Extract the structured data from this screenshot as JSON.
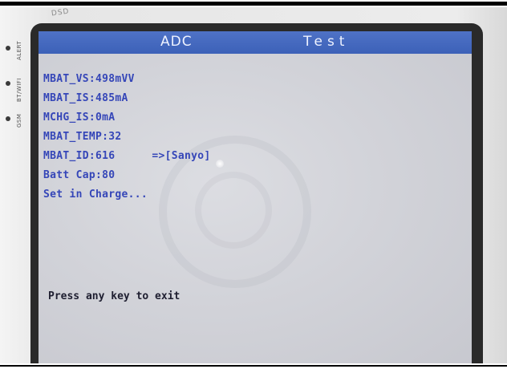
{
  "device": {
    "badge": "DSD",
    "side_labels": [
      "ALERT",
      "BT/WIFI",
      "GSM"
    ]
  },
  "screen": {
    "title_left": "ADC",
    "title_right": "Test",
    "lines": [
      {
        "label": "MBAT_VS:",
        "value": "498mVV"
      },
      {
        "label": "MBAT_IS:",
        "value": "485mA"
      },
      {
        "label": "MCHG_IS:",
        "value": "0mA"
      },
      {
        "label": "MBAT_TEMP:",
        "value": "32"
      },
      {
        "label": "MBAT_ID:",
        "value": "616",
        "suffix": "=>[Sanyo]"
      },
      {
        "label": "Batt Cap:",
        "value": "80"
      },
      {
        "label": "Set in Charge...",
        "value": ""
      }
    ],
    "exit_prompt": "Press any key to exit"
  },
  "colors": {
    "title_bar": "#3f63bb",
    "text_blue": "#3546b8",
    "screen_bg": "#d2d3d9"
  }
}
